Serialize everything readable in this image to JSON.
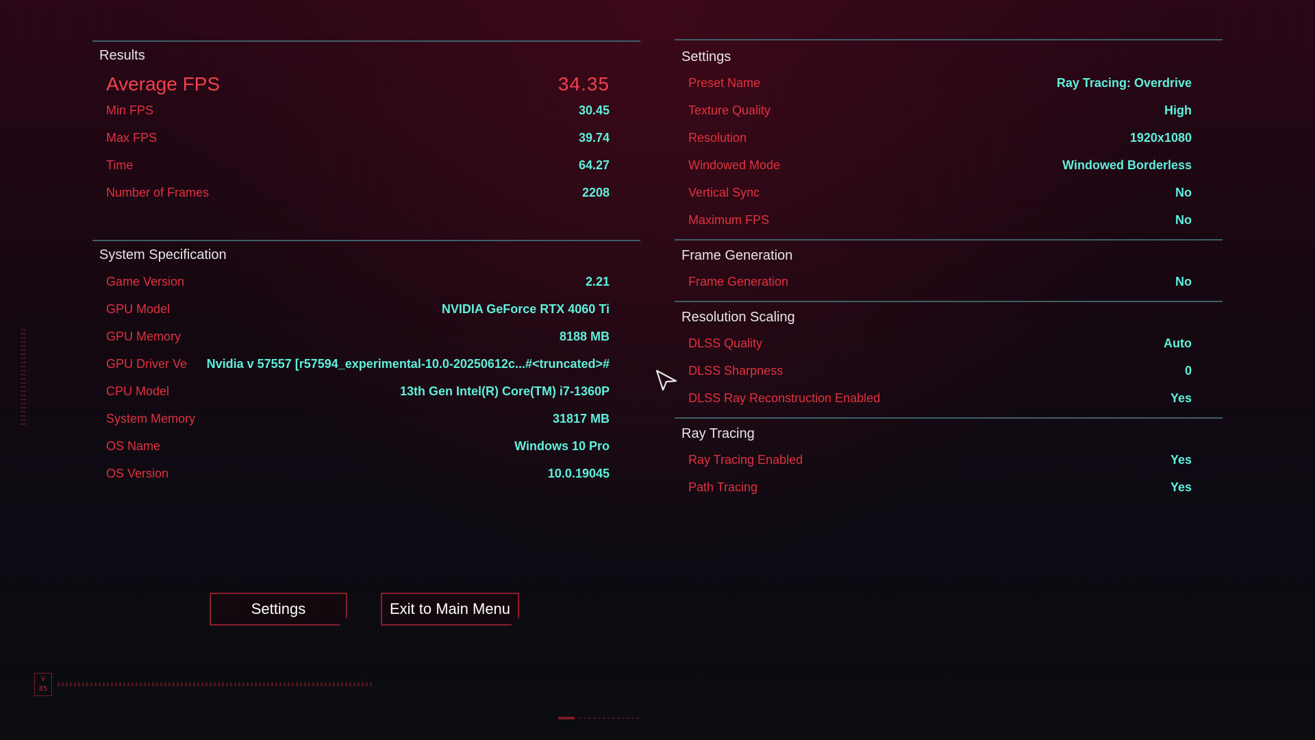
{
  "results": {
    "title": "Results",
    "average": {
      "label": "Average FPS",
      "value": "34.35"
    },
    "rows": [
      {
        "label": "Min FPS",
        "value": "30.45"
      },
      {
        "label": "Max FPS",
        "value": "39.74"
      },
      {
        "label": "Time",
        "value": "64.27"
      },
      {
        "label": "Number of Frames",
        "value": "2208"
      }
    ]
  },
  "system": {
    "title": "System Specification",
    "rows": [
      {
        "label": "Game Version",
        "value": "2.21"
      },
      {
        "label": "GPU Model",
        "value": "NVIDIA GeForce RTX 4060 Ti"
      },
      {
        "label": "GPU Memory",
        "value": "8188 MB"
      },
      {
        "label": "GPU Driver Ve",
        "value": "Nvidia v 57557 [r57594_experimental-10.0-20250612c...#<truncated>#"
      },
      {
        "label": "CPU Model",
        "value": "13th Gen Intel(R) Core(TM) i7-1360P"
      },
      {
        "label": "System Memory",
        "value": "31817 MB"
      },
      {
        "label": "OS Name",
        "value": "Windows 10 Pro"
      },
      {
        "label": "OS Version",
        "value": "10.0.19045"
      }
    ]
  },
  "settings": {
    "title": "Settings",
    "rows": [
      {
        "label": "Preset Name",
        "value": "Ray Tracing: Overdrive"
      },
      {
        "label": "Texture Quality",
        "value": "High"
      },
      {
        "label": "Resolution",
        "value": "1920x1080"
      },
      {
        "label": "Windowed Mode",
        "value": "Windowed Borderless"
      },
      {
        "label": "Vertical Sync",
        "value": "No"
      },
      {
        "label": "Maximum FPS",
        "value": "No"
      }
    ]
  },
  "frame_generation": {
    "title": "Frame Generation",
    "rows": [
      {
        "label": "Frame Generation",
        "value": "No"
      }
    ]
  },
  "resolution_scaling": {
    "title": "Resolution Scaling",
    "rows": [
      {
        "label": "DLSS Quality",
        "value": "Auto"
      },
      {
        "label": "DLSS Sharpness",
        "value": "0"
      },
      {
        "label": "DLSS Ray Reconstruction Enabled",
        "value": "Yes"
      }
    ]
  },
  "ray_tracing": {
    "title": "Ray Tracing",
    "rows": [
      {
        "label": "Ray Tracing Enabled",
        "value": "Yes"
      },
      {
        "label": "Path Tracing",
        "value": "Yes"
      }
    ]
  },
  "buttons": {
    "settings_label": "Settings",
    "exit_label": "Exit to Main Menu"
  },
  "colors": {
    "label_red": "#e0323f",
    "value_cyan": "#5ff0dc",
    "divider": "#3e6068",
    "button_border": "#8a1f2c"
  },
  "icons": {
    "cursor": "arrow-cursor-icon",
    "version_badge": "version-badge-icon"
  }
}
